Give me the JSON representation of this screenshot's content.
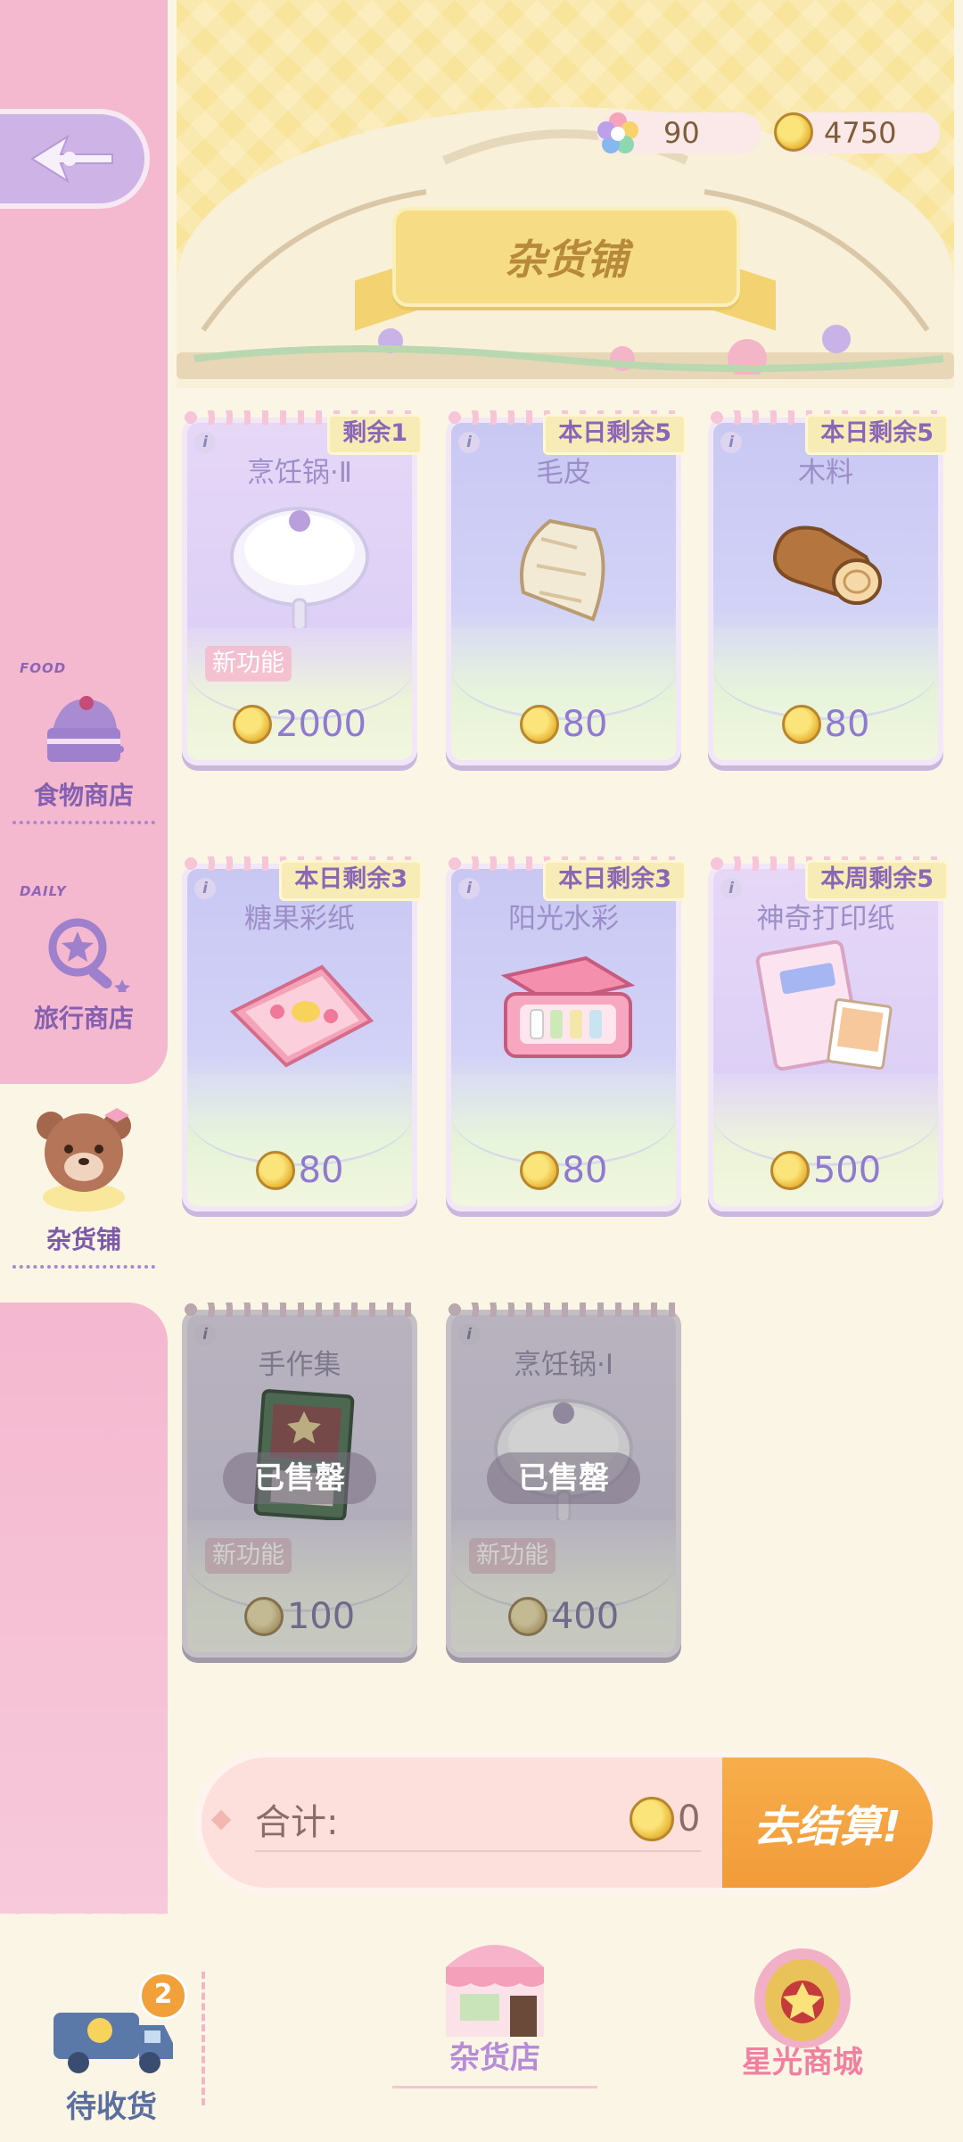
{
  "header": {
    "title": "杂货铺",
    "star_currency": "90",
    "coin_currency": "4750"
  },
  "sidebar": {
    "items": [
      {
        "tag": "FOOD",
        "label": "食物商店",
        "icon": "cake-icon",
        "active": false
      },
      {
        "tag": "DAILY",
        "label": "旅行商店",
        "icon": "magnifier-star-icon",
        "active": false
      },
      {
        "tag": "",
        "label": "杂货铺",
        "icon": "bear-avatar-icon",
        "active": true
      }
    ]
  },
  "cards": [
    {
      "name": "烹饪锅·Ⅱ",
      "remain": "剩余1",
      "price": "2000",
      "new_tag": "新功能",
      "sold": false,
      "icon": "pan-icon"
    },
    {
      "name": "毛皮",
      "remain": "本日剩余5",
      "price": "80",
      "new_tag": "",
      "sold": false,
      "icon": "fur-icon"
    },
    {
      "name": "木料",
      "remain": "本日剩余5",
      "price": "80",
      "new_tag": "",
      "sold": false,
      "icon": "wood-log-icon"
    },
    {
      "name": "糖果彩纸",
      "remain": "本日剩余3",
      "price": "80",
      "new_tag": "",
      "sold": false,
      "icon": "candy-paper-icon"
    },
    {
      "name": "阳光水彩",
      "remain": "本日剩余3",
      "price": "80",
      "new_tag": "",
      "sold": false,
      "icon": "watercolor-box-icon"
    },
    {
      "name": "神奇打印纸",
      "remain": "本周剩余5",
      "price": "500",
      "new_tag": "",
      "sold": false,
      "icon": "print-paper-icon"
    },
    {
      "name": "手作集",
      "remain": "",
      "price": "100",
      "new_tag": "新功能",
      "sold": true,
      "sold_label": "已售罄",
      "icon": "craft-book-icon"
    },
    {
      "name": "烹饪锅·Ⅰ",
      "remain": "",
      "price": "400",
      "new_tag": "新功能",
      "sold": true,
      "sold_label": "已售罄",
      "icon": "pan-icon"
    }
  ],
  "total": {
    "label": "合计:",
    "amount": "0",
    "checkout_label": "去结算!"
  },
  "bottom_nav": {
    "pending": {
      "label": "待收货",
      "badge": "2"
    },
    "grocery": {
      "label": "杂货店"
    },
    "starlight": {
      "label": "星光商城"
    }
  },
  "colors": {
    "accent_purple": "#8560b0",
    "checkout_orange": "#f29b3a",
    "sidebar_pink": "#f4b8cf",
    "header_yellow": "#f9e49c"
  }
}
